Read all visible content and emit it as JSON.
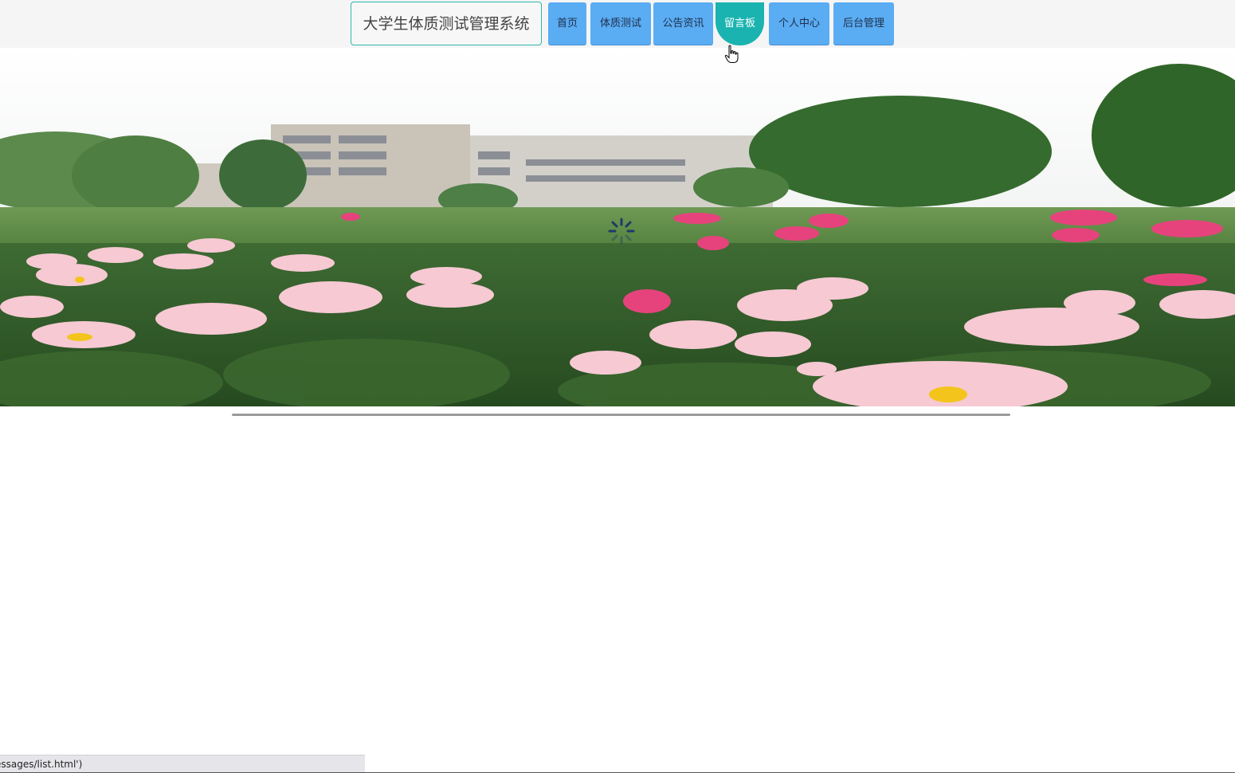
{
  "header": {
    "site_title": "大学生体质测试管理系统",
    "nav": [
      {
        "label": "首页",
        "active": false
      },
      {
        "label": "体质测试",
        "active": false
      },
      {
        "label": "公告资讯",
        "active": false
      },
      {
        "label": "留言板",
        "active": true
      },
      {
        "label": "个人中心",
        "active": false
      },
      {
        "label": "后台管理",
        "active": false
      }
    ]
  },
  "hero": {
    "image": "campus-peony-garden-banner"
  },
  "status_bar": {
    "text": "essages/list.html')"
  },
  "colors": {
    "nav_button": "#5aacf3",
    "nav_active": "#1ab3b0",
    "title_border": "#2fb9a9",
    "topbar_bg": "#f5f5f5"
  }
}
